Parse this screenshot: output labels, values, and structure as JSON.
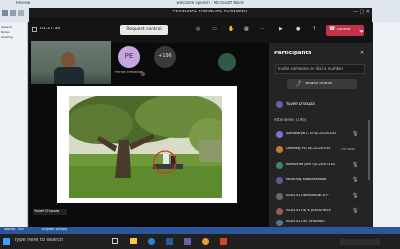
{
  "word": {
    "title": "welcome speech - Microsoft Word",
    "ribbon_tab": "Review",
    "left_labels": [
      "Speech",
      "Notes",
      "Spelling"
    ],
    "status_words": "Words: 765",
    "status_language": "English (India)"
  },
  "taskbar": {
    "search_placeholder": "Type here to search"
  },
  "teams": {
    "meeting_title": "PERSONAL FINANCIAL PLANNING",
    "timer": "01:27:36",
    "request_control": "Request control",
    "leave": "Leave",
    "presenter_initials": "PE",
    "presenter_name": "Prince Fernando",
    "more_count": "+196",
    "presenter_label": "Yuvell D'souza",
    "icons": [
      "camera-icon",
      "mic-icon",
      "share-icon",
      "more-icon",
      "hand-icon",
      "chat-icon",
      "people-icon",
      "grid-icon",
      "phone-icon"
    ]
  },
  "participants": {
    "title": "Participants",
    "invite_placeholder": "Invite someone or dial a number",
    "share_invite": "Share invite",
    "presenter_name": "Yuvell D'souza",
    "attendees_label": "Attendees (196)",
    "attendees": [
      {
        "name": "Aishwarya C N SJC2020202",
        "status": ""
      },
      {
        "name": "Dheeraj PD SJC2020344",
        "status": "On hold"
      },
      {
        "name": "Karishma Jain SJC2020318",
        "status": ""
      },
      {
        "name": "Muttung Madikeshwar",
        "status": ""
      },
      {
        "name": "N1815219BHAVANI A P",
        "status": ""
      },
      {
        "name": "N1815219J K JAYASHREE",
        "status": ""
      },
      {
        "name": "N1815219S SHAMBU",
        "status": ""
      }
    ]
  },
  "colors": {
    "accent": "#6264a7",
    "leave": "#c4314b",
    "word_blue": "#2b579a"
  }
}
